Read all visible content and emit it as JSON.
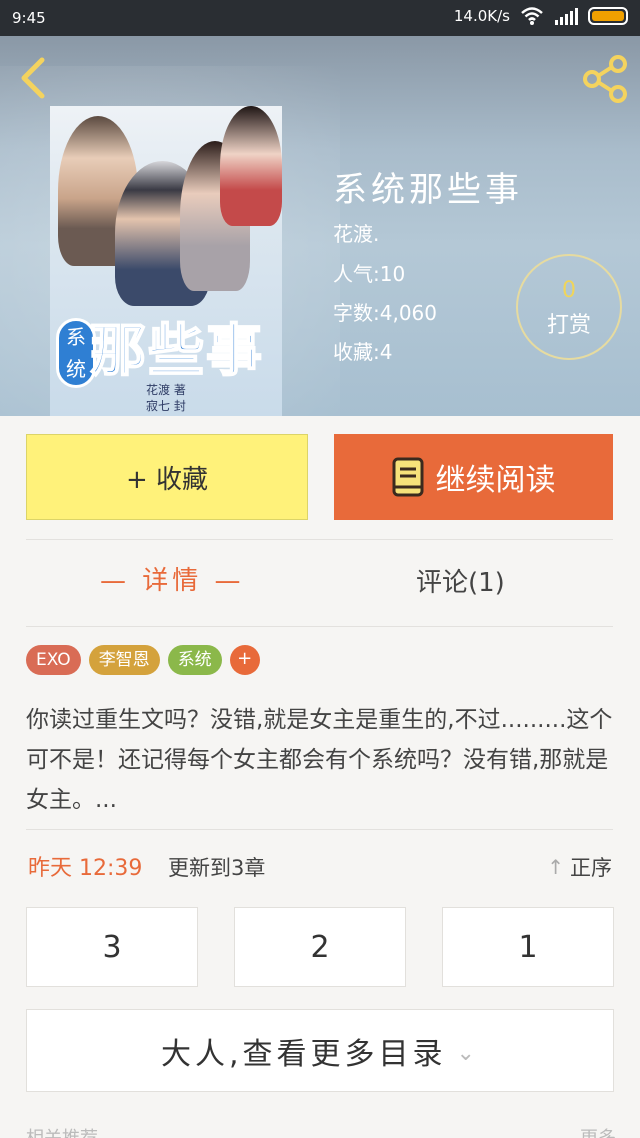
{
  "status_bar": {
    "time": "9:45",
    "network_speed": "14.0K/s"
  },
  "book": {
    "title": "系统那些事",
    "author": "花渡.",
    "popularity": "人气:10",
    "word_count": "字数:4,060",
    "favorites": "收藏:4",
    "cover": {
      "badge_text": "系统",
      "title_text": "那些事",
      "author_line1": "花渡 著",
      "author_line2": "寂七 封"
    }
  },
  "reward": {
    "count": "0",
    "label": "打赏"
  },
  "actions": {
    "favorite_label": "+ 收藏",
    "continue_label": "继续阅读"
  },
  "tabs": {
    "detail": "— 详情 —",
    "comments": "评论(1)"
  },
  "tags": [
    {
      "label": "EXO",
      "color": "#d96c55"
    },
    {
      "label": "李智恩",
      "color": "#d4a23c"
    },
    {
      "label": "系统",
      "color": "#8bb84a"
    }
  ],
  "tag_add": "+",
  "synopsis": "你读过重生文吗？没错,就是女主是重生的,不过.........这个可不是！还记得每个女主都会有个系统吗？没有错,那就是女主。...",
  "update": {
    "time": "昨天 12:39",
    "text": "更新到3章",
    "sort_label": "正序",
    "sort_arrow": "↑"
  },
  "chapters": [
    "3",
    "2",
    "1"
  ],
  "more_catalog": {
    "label": "大人,查看更多目录",
    "chevron": "⌄"
  },
  "footer_partial": {
    "left": "相关推荐",
    "right": "更多"
  }
}
